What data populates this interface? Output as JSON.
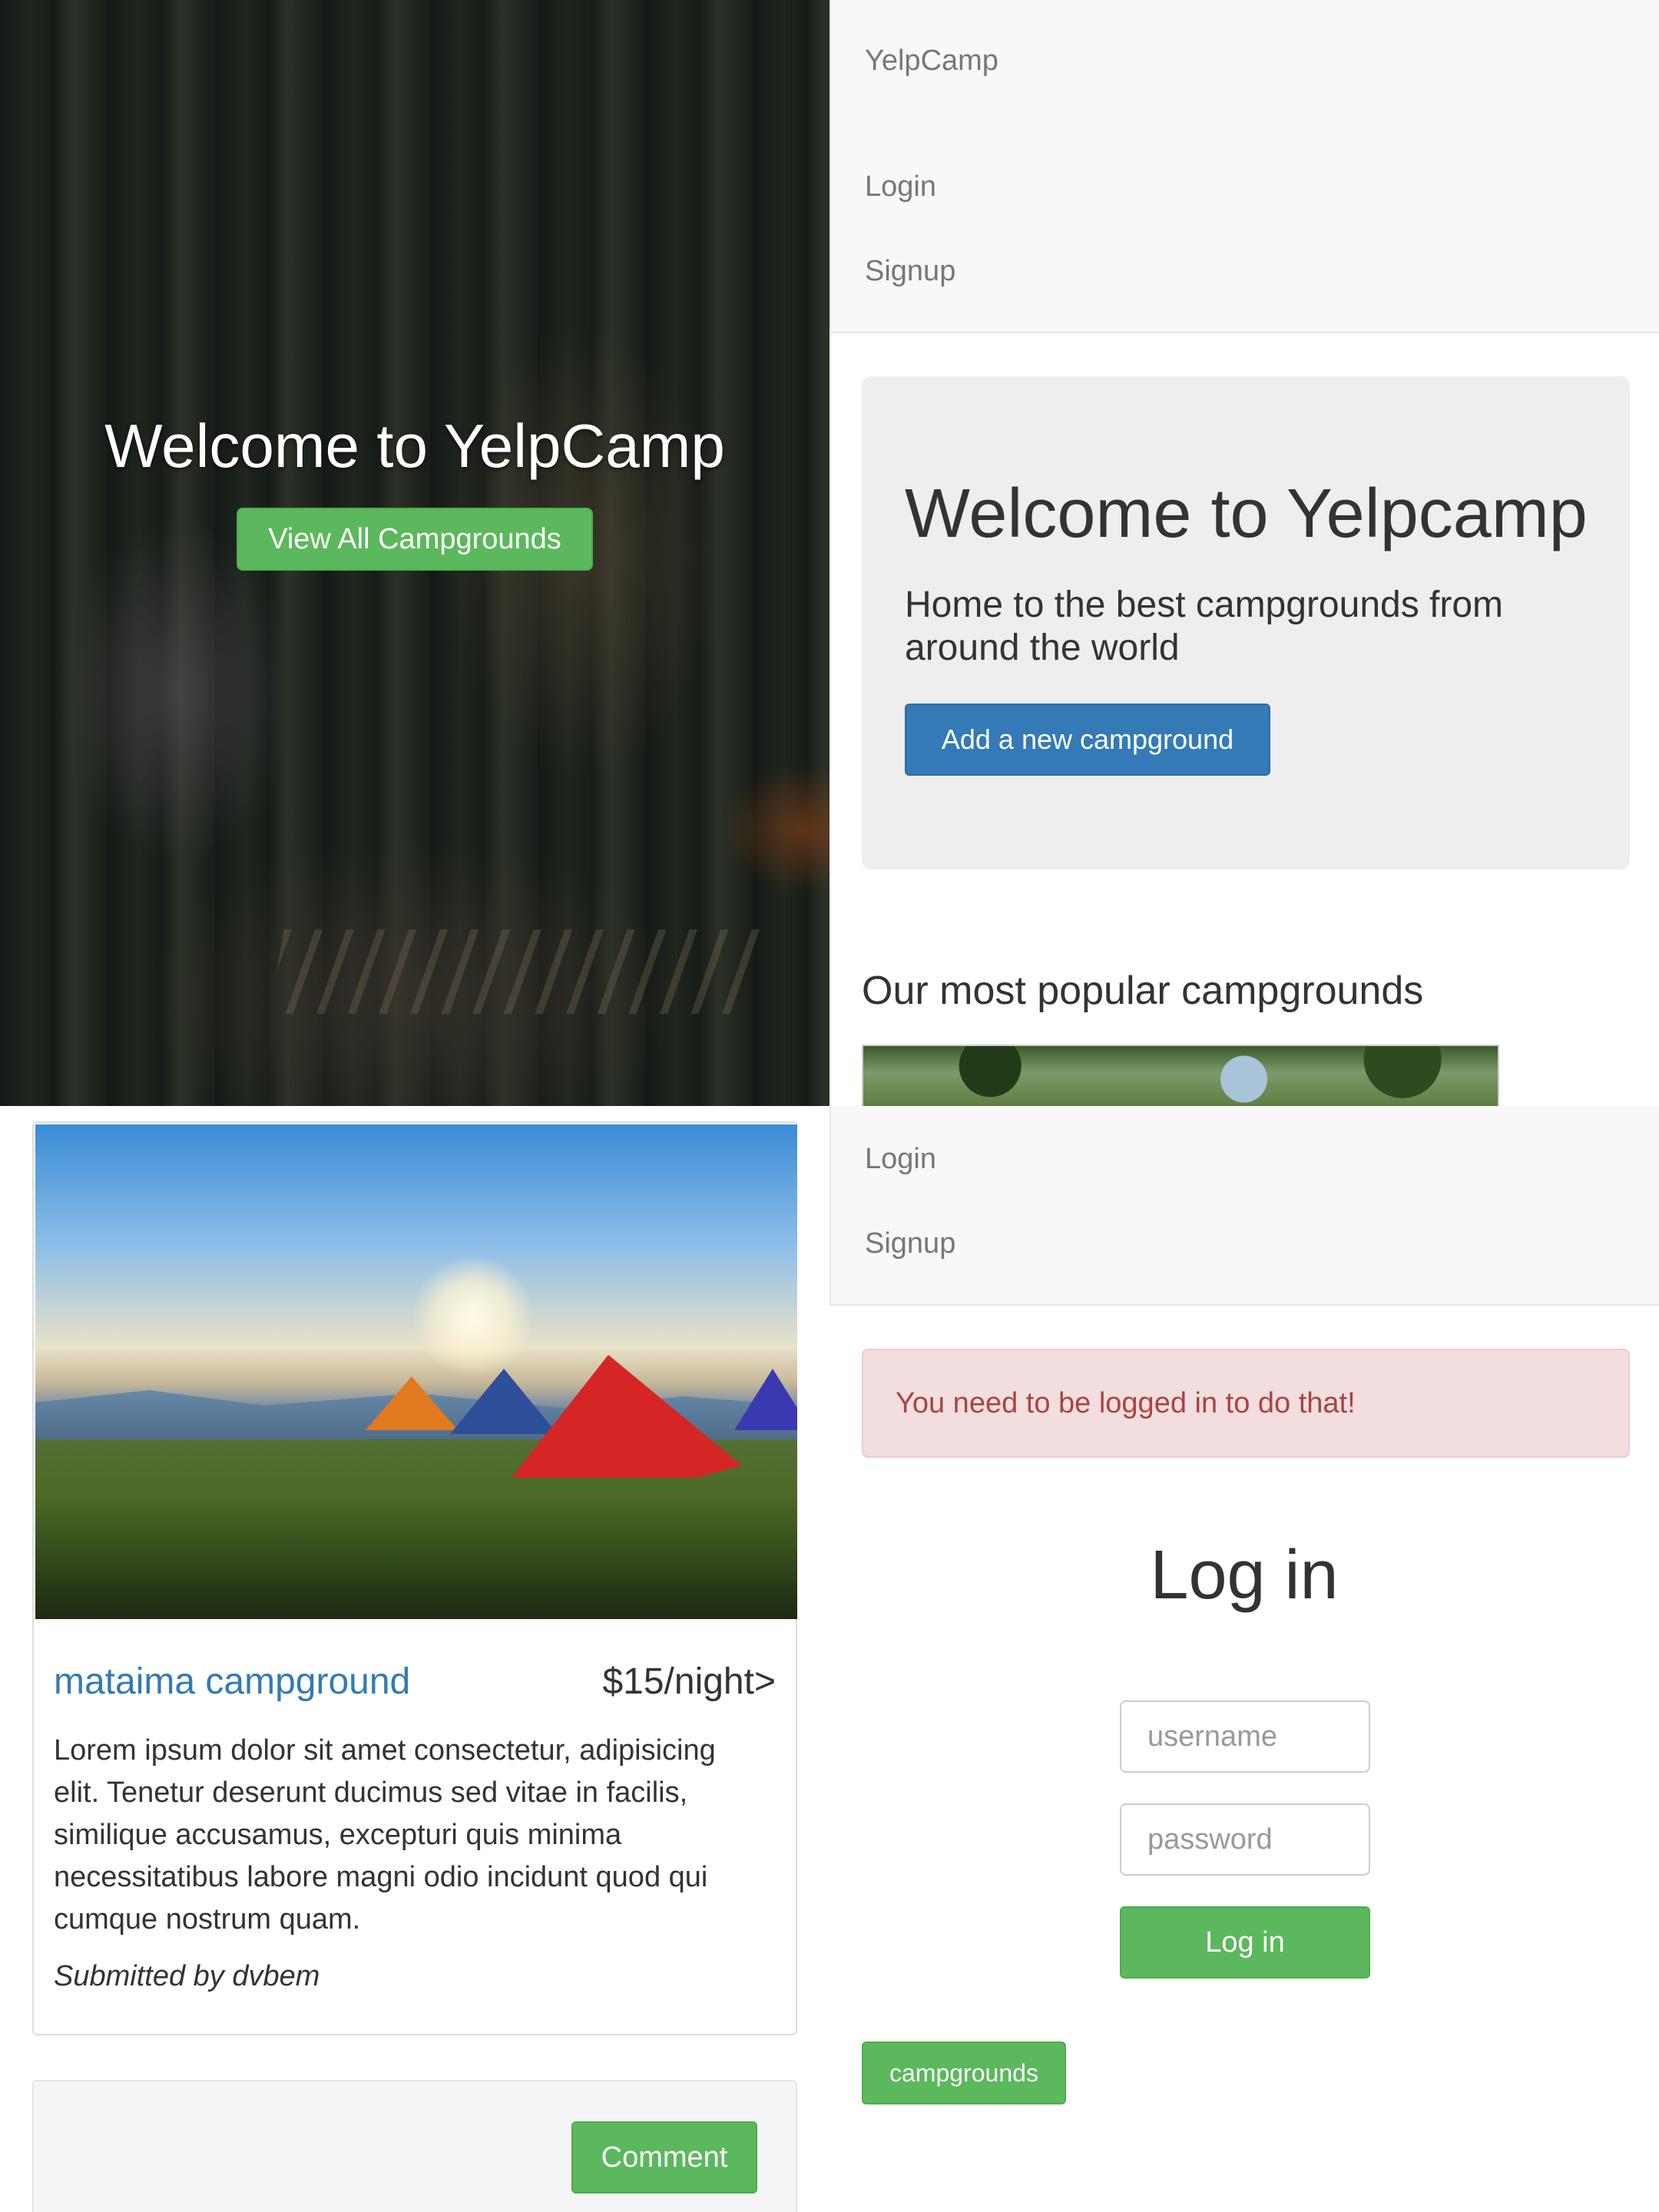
{
  "landing": {
    "title": "Welcome to YelpCamp",
    "view_button": "View All Campgrounds"
  },
  "index": {
    "brand": "YelpCamp",
    "nav": {
      "login": "Login",
      "signup": "Signup"
    },
    "jumbotron": {
      "heading": "Welcome to Yelpcamp",
      "subheading": "Home to the best campgrounds from around the world",
      "add_button": "Add a new campground"
    },
    "popular_heading": "Our most popular campgrounds"
  },
  "show": {
    "name": "mataima campground",
    "price": "$15/night>",
    "description": "Lorem ipsum dolor sit amet consectetur, adipisicing elit. Tenetur deserunt ducimus sed vitae in facilis, similique accusamus, excepturi quis minima necessitatibus labore magni odio incidunt quod qui cumque nostrum quam.",
    "author": "Submitted by dvbem",
    "comment_button": "Comment"
  },
  "login": {
    "nav": {
      "login": "Login",
      "signup": "Signup"
    },
    "alert": "You need to be logged in to do that!",
    "heading": "Log in",
    "username_placeholder": "username",
    "password_placeholder": "password",
    "submit": "Log in",
    "back_button": "campgrounds"
  },
  "colors": {
    "success": "#5cb85c",
    "primary": "#337ab7",
    "danger_bg": "#f2dede",
    "danger_text": "#a94442"
  }
}
